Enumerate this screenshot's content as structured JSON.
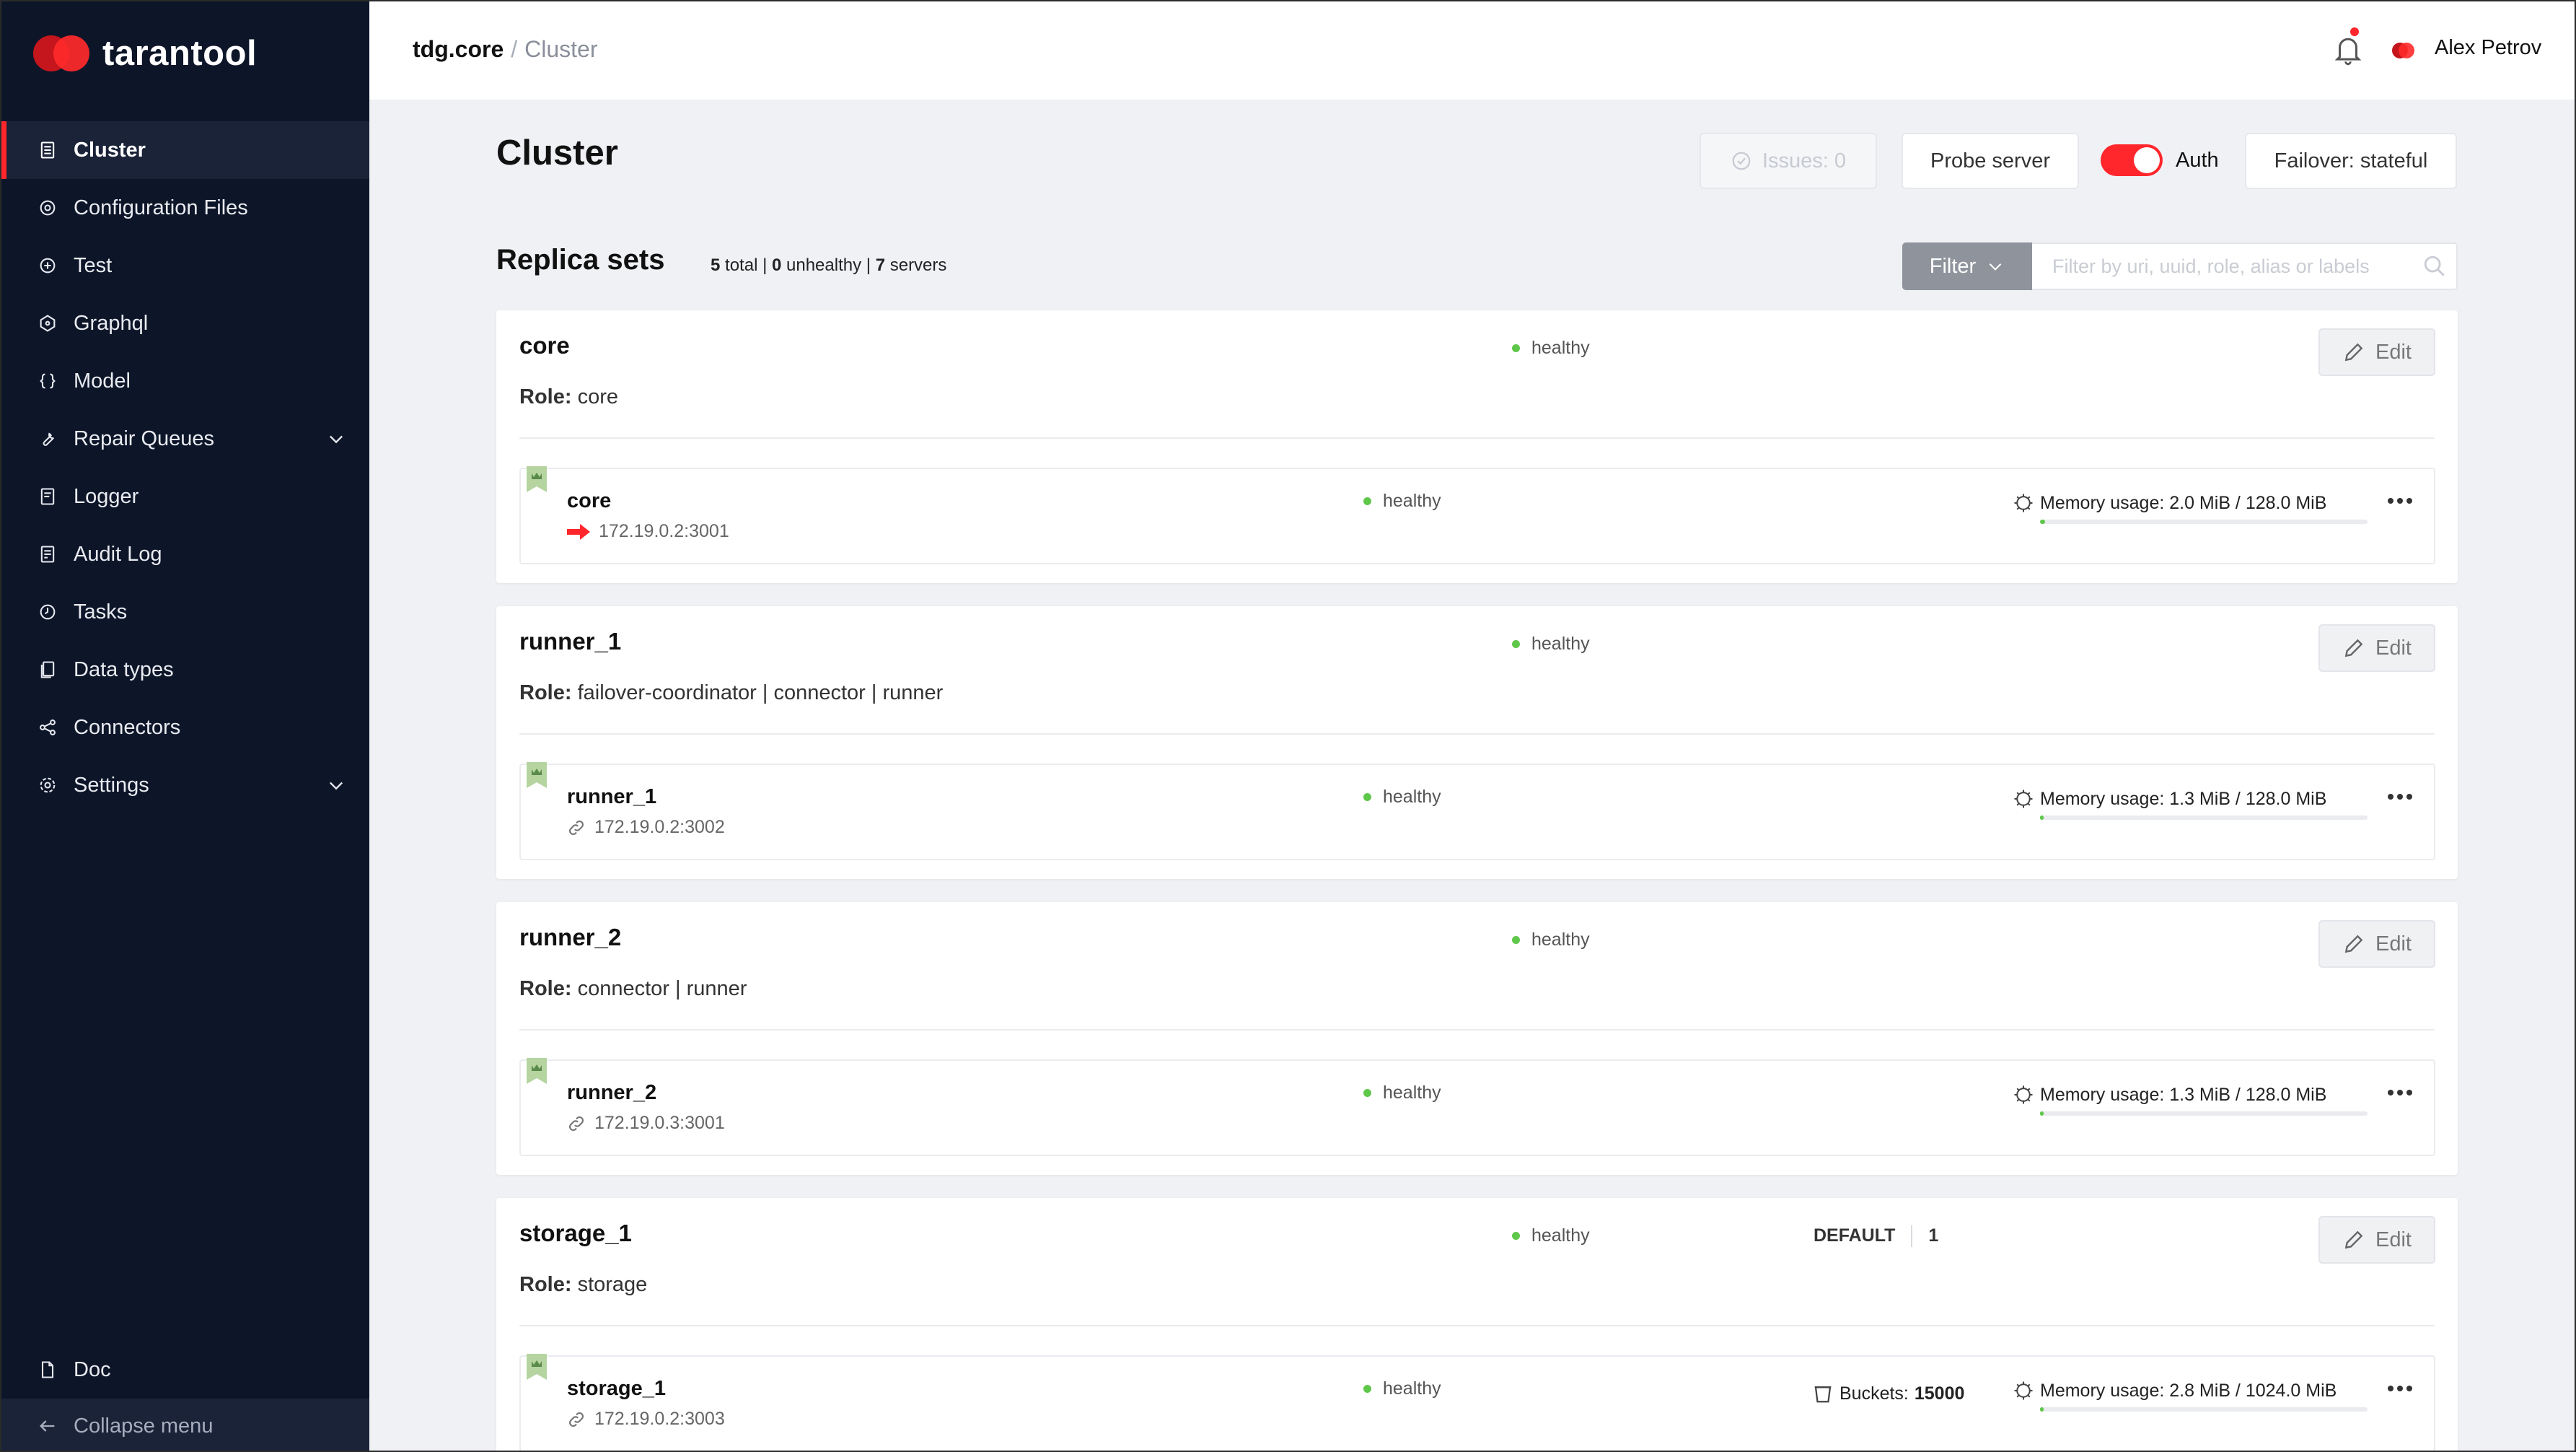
{
  "app": {
    "logo_text": "tarantool"
  },
  "sidebar": {
    "items": [
      {
        "label": "Cluster",
        "icon": "cluster-icon",
        "active": true
      },
      {
        "label": "Configuration Files",
        "icon": "config-icon"
      },
      {
        "label": "Test",
        "icon": "test-icon"
      },
      {
        "label": "Graphql",
        "icon": "graphql-icon"
      },
      {
        "label": "Model",
        "icon": "braces-icon"
      },
      {
        "label": "Repair Queues",
        "icon": "wrench-icon",
        "expandable": true
      },
      {
        "label": "Logger",
        "icon": "logger-icon"
      },
      {
        "label": "Audit Log",
        "icon": "audit-log-icon"
      },
      {
        "label": "Tasks",
        "icon": "clock-icon"
      },
      {
        "label": "Data types",
        "icon": "data-types-icon"
      },
      {
        "label": "Connectors",
        "icon": "share-icon"
      },
      {
        "label": "Settings",
        "icon": "gear-icon",
        "expandable": true
      }
    ],
    "doc_label": "Doc",
    "collapse_label": "Collapse menu"
  },
  "header": {
    "breadcrumb_root": "tdg.core",
    "breadcrumb_sep": "/",
    "breadcrumb_current": "Cluster",
    "user_name": "Alex Petrov"
  },
  "main": {
    "title": "Cluster",
    "issues_label": "Issues: 0",
    "probe_label": "Probe server",
    "auth_label": "Auth",
    "auth_enabled": true,
    "failover_label": "Failover: stateful",
    "replica_sets_title": "Replica sets",
    "stats": {
      "total": "5",
      "total_label": "total",
      "unhealthy": "0",
      "unhealthy_label": "unhealthy",
      "servers": "7",
      "servers_label": "servers",
      "sep": "|"
    },
    "filter_label": "Filter",
    "filter_placeholder": "Filter by uri, uuid, role, alias or labels"
  },
  "replica_sets": [
    {
      "name": "core",
      "status": "healthy",
      "role_label": "Role:",
      "roles": "core",
      "edit_label": "Edit",
      "server": {
        "name": "core",
        "uri": "172.19.0.2:3001",
        "uri_icon": "arrow-right-icon",
        "status": "healthy",
        "memory_label": "Memory usage: 2.0 MiB / 128.0 MiB",
        "memory_fraction": 0.016
      }
    },
    {
      "name": "runner_1",
      "status": "healthy",
      "role_label": "Role:",
      "roles": "failover-coordinator | connector | runner",
      "edit_label": "Edit",
      "server": {
        "name": "runner_1",
        "uri": "172.19.0.2:3002",
        "uri_icon": "link-icon",
        "status": "healthy",
        "memory_label": "Memory usage: 1.3 MiB / 128.0 MiB",
        "memory_fraction": 0.01
      }
    },
    {
      "name": "runner_2",
      "status": "healthy",
      "role_label": "Role:",
      "roles": "connector | runner",
      "edit_label": "Edit",
      "server": {
        "name": "runner_2",
        "uri": "172.19.0.3:3001",
        "uri_icon": "link-icon",
        "status": "healthy",
        "memory_label": "Memory usage: 1.3 MiB / 128.0 MiB",
        "memory_fraction": 0.01
      }
    },
    {
      "name": "storage_1",
      "status": "healthy",
      "role_label": "Role:",
      "roles": "storage",
      "edit_label": "Edit",
      "weight_group": "DEFAULT",
      "weight_value": "1",
      "server": {
        "name": "storage_1",
        "uri": "172.19.0.2:3003",
        "uri_icon": "link-icon",
        "status": "healthy",
        "buckets_label": "Buckets:",
        "buckets_value": "15000",
        "memory_label": "Memory usage: 2.8 MiB / 1024.0 MiB",
        "memory_fraction": 0.003
      }
    }
  ],
  "colors": {
    "accent": "#ff272c",
    "sidebar_bg": "#0d1529",
    "healthy": "#5fc74a"
  }
}
